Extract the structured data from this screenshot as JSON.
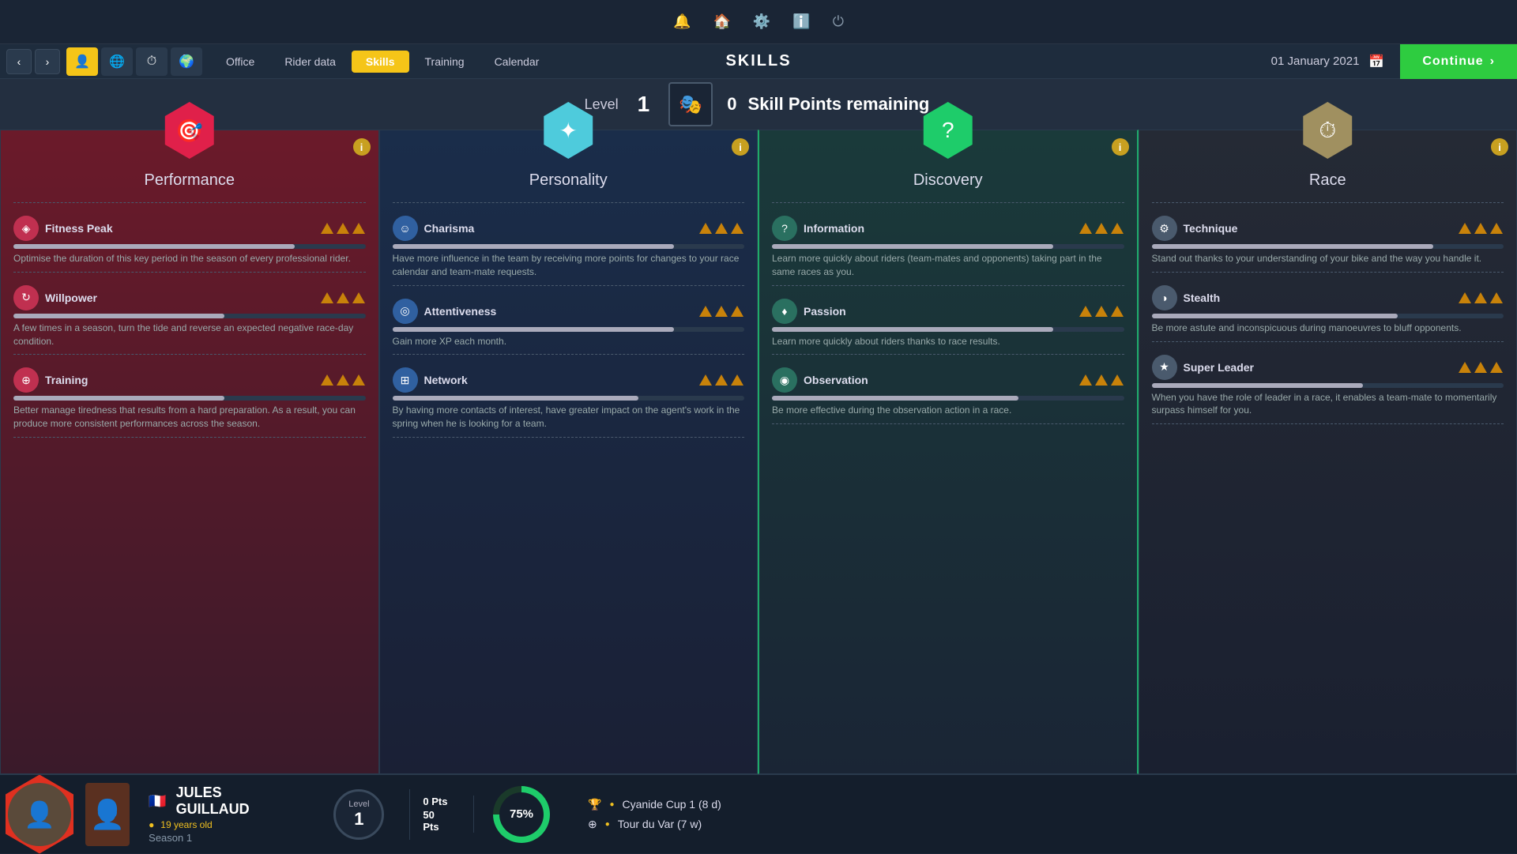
{
  "topBar": {
    "icons": [
      "🔔",
      "🏠",
      "⚙️",
      "ℹ️",
      "⏻"
    ]
  },
  "navRow": {
    "arrowLeft": "‹",
    "arrowRight": "›",
    "iconBtns": [
      {
        "icon": "👤",
        "active": true
      },
      {
        "icon": "🌐",
        "active": false
      },
      {
        "icon": "⏱",
        "active": false
      },
      {
        "icon": "🌍",
        "active": false
      }
    ],
    "tabs": [
      {
        "label": "Office",
        "active": false
      },
      {
        "label": "Rider data",
        "active": false
      },
      {
        "label": "Skills",
        "active": true
      },
      {
        "label": "Training",
        "active": false
      },
      {
        "label": "Calendar",
        "active": false
      }
    ],
    "pageTitle": "SKILLS",
    "date": "01 January 2021",
    "continueLabel": "Continue"
  },
  "levelBar": {
    "levelLabel": "Level",
    "levelNum": "1",
    "skillPoints": "0",
    "skillPointsLabel": "Skill Points remaining"
  },
  "cards": [
    {
      "id": "performance",
      "title": "Performance",
      "hexColor": "hex-red",
      "hexIcon": "🎯",
      "skills": [
        {
          "name": "Fitness Peak",
          "iconClass": "red",
          "iconGlyph": "◈",
          "stars": 3,
          "barFill": 80,
          "desc": "Optimise the duration of this key period in the season of every professional rider."
        },
        {
          "name": "Willpower",
          "iconClass": "red",
          "iconGlyph": "↻",
          "stars": 3,
          "barFill": 60,
          "desc": "A few times in a season, turn the tide and reverse an expected negative race-day condition."
        },
        {
          "name": "Training",
          "iconClass": "red",
          "iconGlyph": "⊕",
          "stars": 3,
          "barFill": 60,
          "desc": "Better manage tiredness that results from a hard preparation. As a result, you can produce more consistent performances across the season."
        }
      ]
    },
    {
      "id": "personality",
      "title": "Personality",
      "hexColor": "hex-cyan",
      "hexIcon": "✦",
      "skills": [
        {
          "name": "Charisma",
          "iconClass": "blue",
          "iconGlyph": "☺",
          "stars": 3,
          "barFill": 80,
          "desc": "Have more influence in the team by receiving more points for changes to your race calendar and team-mate requests."
        },
        {
          "name": "Attentiveness",
          "iconClass": "blue",
          "iconGlyph": "◎",
          "stars": 3,
          "barFill": 80,
          "desc": "Gain more XP each month."
        },
        {
          "name": "Network",
          "iconClass": "blue",
          "iconGlyph": "⊞",
          "stars": 3,
          "barFill": 70,
          "desc": "By having more contacts of interest, have greater impact on the agent's work in the spring when he is looking for a team."
        }
      ]
    },
    {
      "id": "discovery",
      "title": "Discovery",
      "hexColor": "hex-green",
      "hexIcon": "?",
      "skills": [
        {
          "name": "Information",
          "iconClass": "teal",
          "iconGlyph": "?",
          "stars": 3,
          "barFill": 80,
          "desc": "Learn more quickly about riders (team-mates and opponents) taking part in the same races as you."
        },
        {
          "name": "Passion",
          "iconClass": "teal",
          "iconGlyph": "♦",
          "stars": 3,
          "barFill": 80,
          "desc": "Learn more quickly about riders thanks to race results."
        },
        {
          "name": "Observation",
          "iconClass": "teal",
          "iconGlyph": "◉",
          "stars": 3,
          "barFill": 70,
          "desc": "Be more effective during the observation action in a race."
        }
      ]
    },
    {
      "id": "race",
      "title": "Race",
      "hexColor": "hex-tan",
      "hexIcon": "⏱",
      "skills": [
        {
          "name": "Technique",
          "iconClass": "gray",
          "iconGlyph": "⚙",
          "stars": 3,
          "barFill": 80,
          "desc": "Stand out thanks to your understanding of your bike and the way you handle it."
        },
        {
          "name": "Stealth",
          "iconClass": "gray",
          "iconGlyph": "◑",
          "stars": 3,
          "barFill": 70,
          "desc": "Be more astute and inconspicuous during manoeuvres to bluff opponents."
        },
        {
          "name": "Super Leader",
          "iconClass": "gray",
          "iconGlyph": "★",
          "stars": 3,
          "barFill": 60,
          "desc": "When you have the role of leader in a race, it enables a team-mate to momentarily surpass himself for you."
        }
      ]
    }
  ],
  "bottomBar": {
    "riderName": "JULES GUILLAUD",
    "riderAge": "19 years old",
    "ageDot": "●",
    "season": "Season 1",
    "flagEmoji": "🇫🇷",
    "levelLabel": "Level",
    "levelNum": "1",
    "pts0": "0 Pts",
    "pts50": "50 Pts",
    "progressPct": "75%",
    "races": [
      {
        "icon": "🏆",
        "name": "Cyanide Cup 1 (8 d)"
      },
      {
        "icon": "⊕",
        "name": "Tour du Var (7 w)"
      }
    ]
  }
}
